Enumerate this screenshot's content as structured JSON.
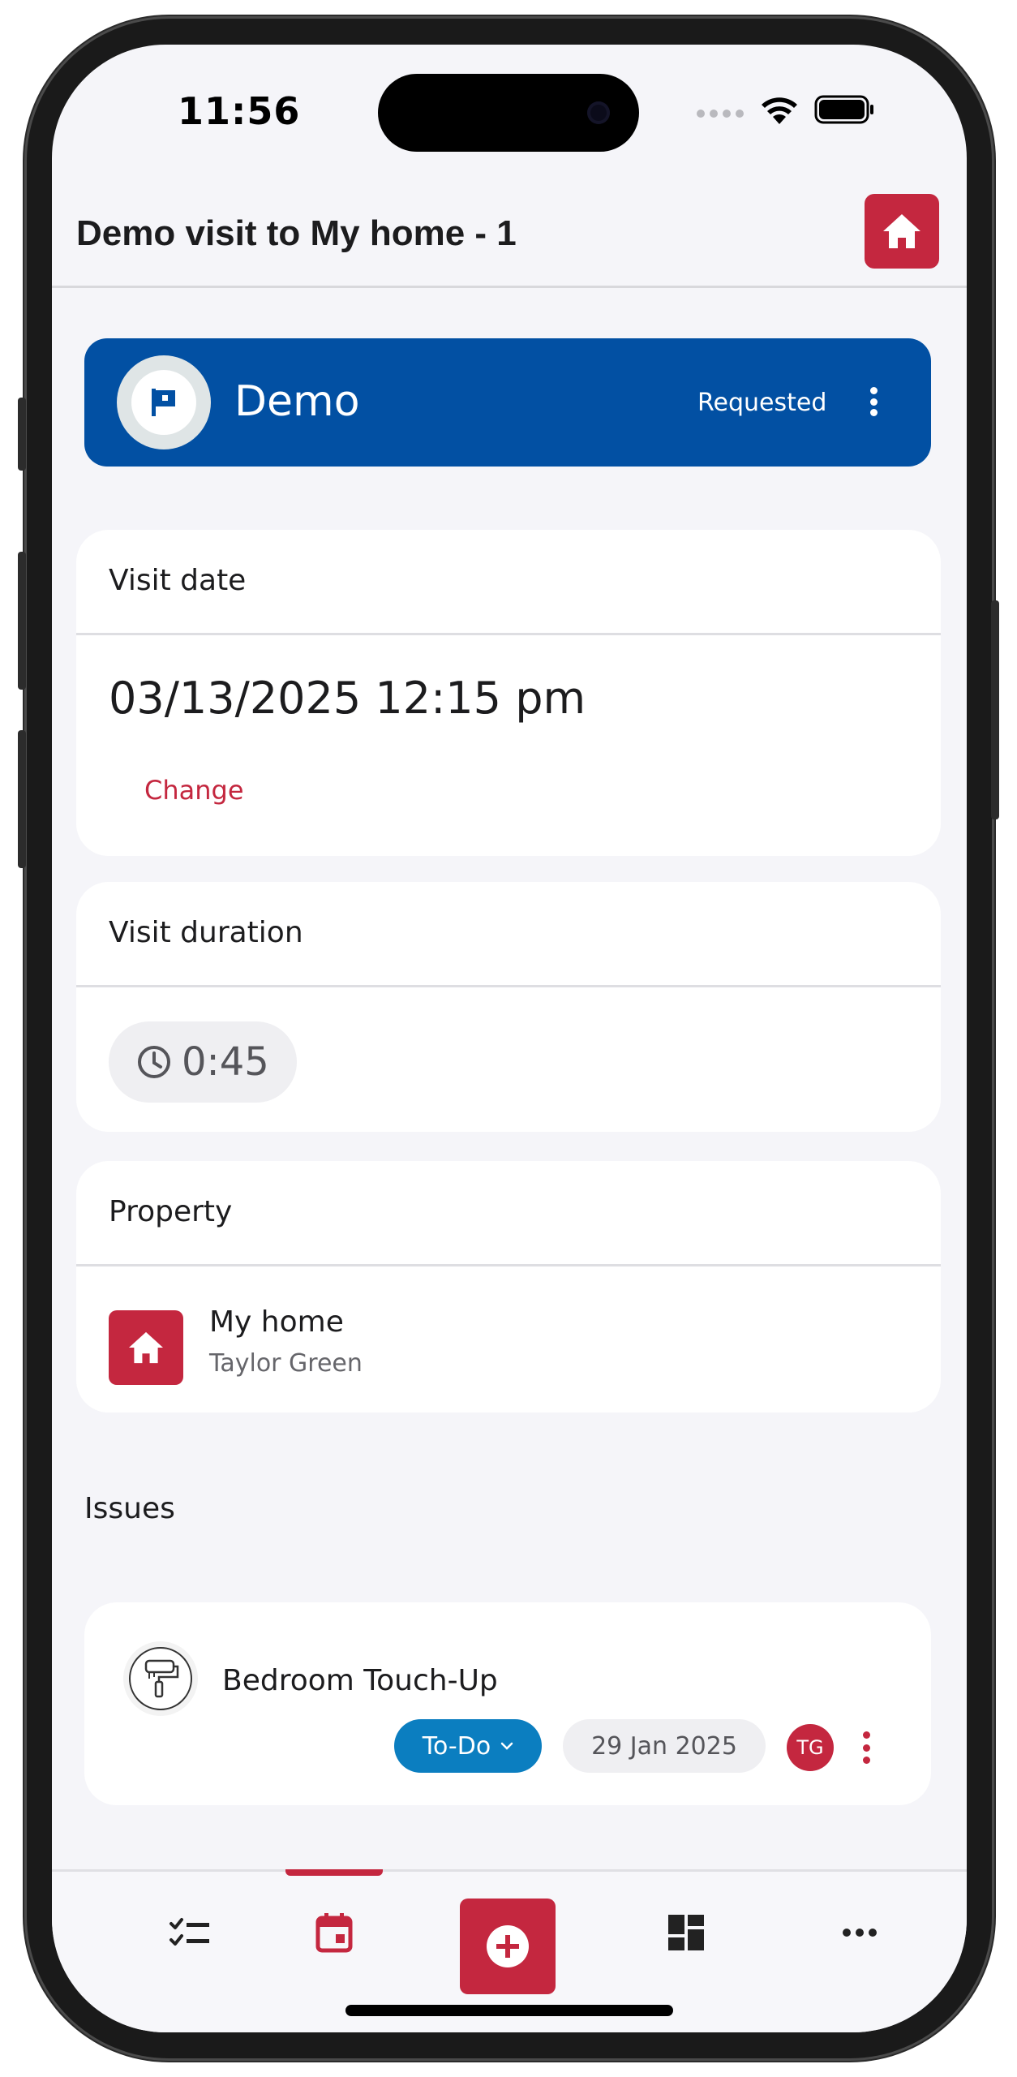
{
  "status_bar": {
    "time": "11:56"
  },
  "header": {
    "title": "Demo visit to My home - 1"
  },
  "visit": {
    "name": "Demo",
    "status": "Requested"
  },
  "visit_date": {
    "label": "Visit date",
    "value": "03/13/2025 12:15 pm",
    "change_label": "Change"
  },
  "visit_duration": {
    "label": "Visit duration",
    "value": "0:45"
  },
  "property": {
    "label": "Property",
    "name": "My home",
    "owner": "Taylor Green"
  },
  "issues": {
    "label": "Issues",
    "items": [
      {
        "title": "Bedroom Touch-Up",
        "status": "To-Do",
        "date": "29 Jan 2025",
        "assignee_initials": "TG"
      }
    ]
  },
  "bottom_nav": {
    "items": [
      "tasks-icon",
      "calendar-icon",
      "add-icon",
      "dashboard-icon",
      "more-icon"
    ],
    "active": "calendar-icon"
  },
  "colors": {
    "brand_red": "#c4273f",
    "banner_blue": "#0250a3",
    "status_blue": "#0b7ec0",
    "background": "#f5f5f9"
  }
}
